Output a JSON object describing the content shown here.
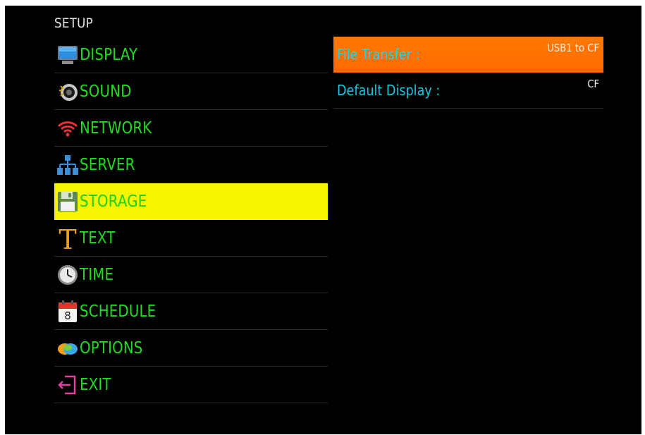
{
  "header": {
    "title": "SETUP"
  },
  "menu": {
    "items": [
      {
        "label": "DISPLAY",
        "icon": "monitor-icon"
      },
      {
        "label": "SOUND",
        "icon": "speaker-icon"
      },
      {
        "label": "NETWORK",
        "icon": "wifi-icon"
      },
      {
        "label": "SERVER",
        "icon": "server-icon"
      },
      {
        "label": "STORAGE",
        "icon": "floppy-disk-icon",
        "selected": true
      },
      {
        "label": "TEXT",
        "icon": "text-t-icon"
      },
      {
        "label": "TIME",
        "icon": "clock-icon"
      },
      {
        "label": "SCHEDULE",
        "icon": "calendar-icon",
        "icon_text": "8"
      },
      {
        "label": "OPTIONS",
        "icon": "options-icon"
      },
      {
        "label": "EXIT",
        "icon": "exit-icon"
      }
    ]
  },
  "settings": {
    "options": [
      {
        "label": "File Transfer :",
        "value": "USB1 to CF",
        "selected": true
      },
      {
        "label": "Default Display :",
        "value": "CF"
      }
    ]
  },
  "colors": {
    "background": "#000000",
    "menu_text": "#1edc1e",
    "menu_selected_bg": "#f5f500",
    "option_text": "#18c8e0",
    "option_selected_bg": "#ff6a00"
  }
}
